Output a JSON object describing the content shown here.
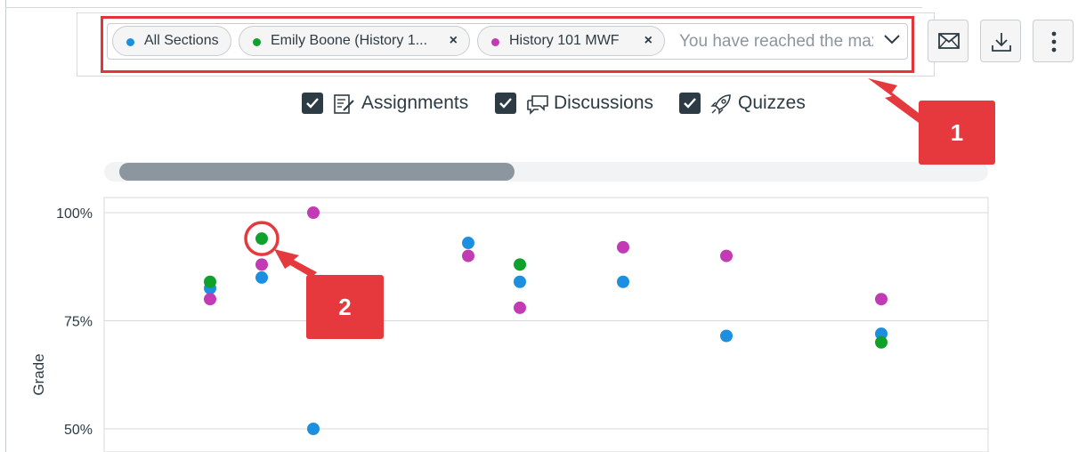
{
  "filters": {
    "tags": [
      {
        "label": "All Sections",
        "dot_color": "#1d8fe0",
        "removable": false
      },
      {
        "label": "Emily Boone (History 1...",
        "dot_color": "#0fa12c",
        "removable": true
      },
      {
        "label": "History 101 MWF",
        "dot_color": "#c23bb4",
        "removable": true
      }
    ],
    "remove_glyph": "×",
    "placeholder": "You have reached the maximum",
    "dropdown_icon": "chevron-down-icon"
  },
  "toolbar": {
    "buttons": [
      {
        "icon": "envelope-icon"
      },
      {
        "icon": "download-icon"
      },
      {
        "icon": "more-vertical-icon"
      }
    ]
  },
  "toggles": [
    {
      "label": "Assignments",
      "checked": true,
      "icon": "assignment-icon"
    },
    {
      "label": "Discussions",
      "checked": true,
      "icon": "discussion-icon"
    },
    {
      "label": "Quizzes",
      "checked": true,
      "icon": "rocket-icon"
    }
  ],
  "scrollbar": {
    "visible_fraction": 0.45,
    "position": 0.0
  },
  "callouts": {
    "first": "1",
    "second": "2"
  },
  "callout_color": "#e5393e",
  "chart_data": {
    "type": "scatter",
    "title": "",
    "ylabel": "Grade",
    "xlabel": "",
    "ylim": [
      45,
      100
    ],
    "yticks": [
      100,
      75,
      50
    ],
    "ytick_labels": [
      "100%",
      "75%",
      "50%"
    ],
    "grid": true,
    "series": [
      {
        "color": "#1d8fe0",
        "points": [
          [
            1,
            82.5
          ],
          [
            2,
            85
          ],
          [
            3,
            50
          ],
          [
            6,
            93
          ],
          [
            7,
            84
          ],
          [
            9,
            84
          ],
          [
            11,
            71.5
          ],
          [
            14,
            72
          ]
        ]
      },
      {
        "color": "#0fa12c",
        "points": [
          [
            1,
            84
          ],
          [
            2,
            94
          ],
          [
            7,
            88
          ],
          [
            14,
            70
          ]
        ]
      },
      {
        "color": "#c23bb4",
        "points": [
          [
            1,
            80
          ],
          [
            2,
            88
          ],
          [
            3,
            100
          ],
          [
            6,
            90
          ],
          [
            7,
            78
          ],
          [
            9,
            92
          ],
          [
            11,
            90
          ],
          [
            14,
            80
          ]
        ]
      }
    ],
    "highlighted_point": {
      "series": 1,
      "index": 1
    }
  }
}
